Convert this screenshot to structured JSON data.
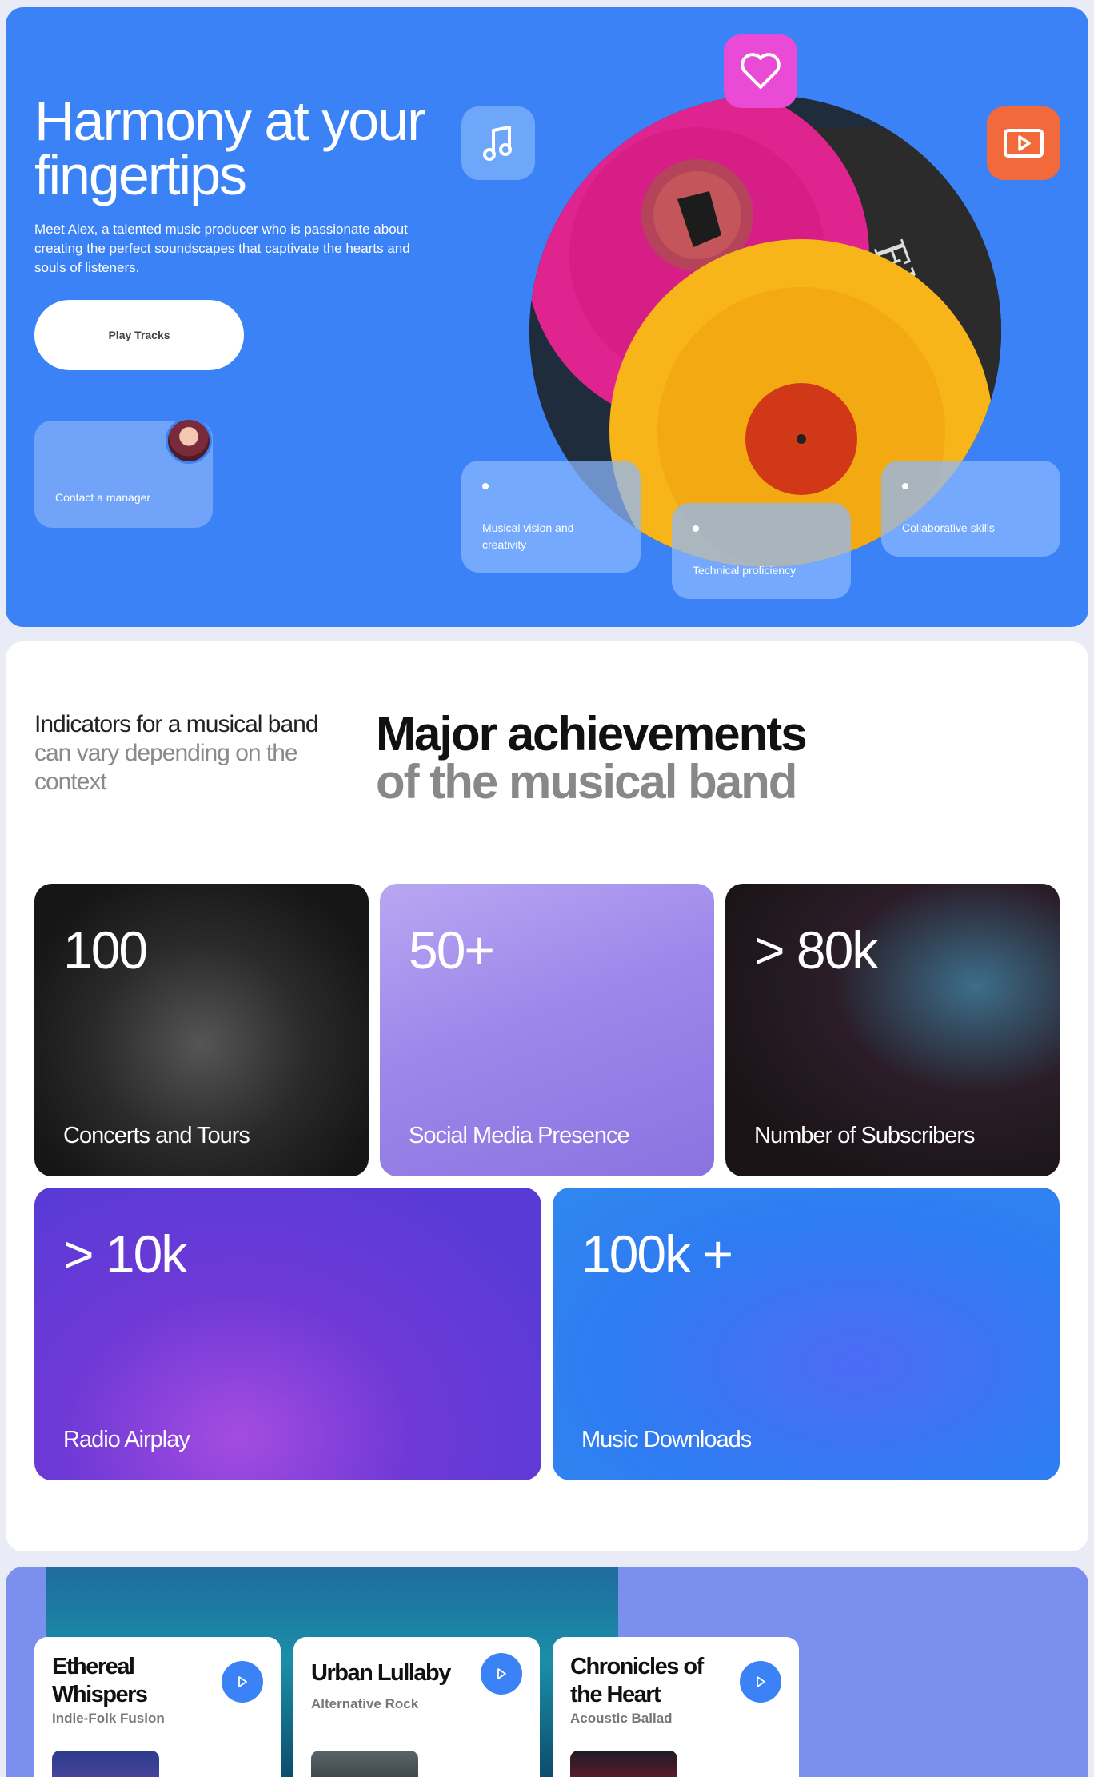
{
  "hero": {
    "title_line1": "Harmony at your",
    "title_line2": "fingertips",
    "description": "Meet Alex, a talented music producer who is passionate about creating the perfect soundscapes that captivate the hearts and souls of listeners.",
    "play_label": "Play Tracks",
    "contact_label": "Contact a manager",
    "skills": [
      "Musical vision and creativity",
      "Technical proficiency",
      "Collaborative skills"
    ],
    "icons": [
      "music-note-icon",
      "heart-icon",
      "video-play-icon"
    ],
    "colors": {
      "accent": "#3b82f6",
      "heart": "#e94bd6",
      "play": "#f26a3c"
    }
  },
  "achievements": {
    "indicators_dark": "Indicators for a musical band",
    "indicators_gray": "can vary depending on the context",
    "major_dark": "Major achievements",
    "major_gray": "of the musical band",
    "stats": [
      {
        "value": "100",
        "label": "Concerts and Tours"
      },
      {
        "value": "50+",
        "label": "Social Media Presence"
      },
      {
        "value": "> 80k",
        "label": "Number of Subscribers"
      },
      {
        "value": "> 10k",
        "label": "Radio Airplay"
      },
      {
        "value": "100k +",
        "label": "Music Downloads"
      }
    ]
  },
  "tracks": [
    {
      "name": "Ethereal Whispers",
      "genre": "Indie-Folk Fusion"
    },
    {
      "name": "Urban Lullaby",
      "genre": "Alternative Rock"
    },
    {
      "name": "Chronicles of the Heart",
      "genre": "Acoustic Ballad"
    }
  ]
}
